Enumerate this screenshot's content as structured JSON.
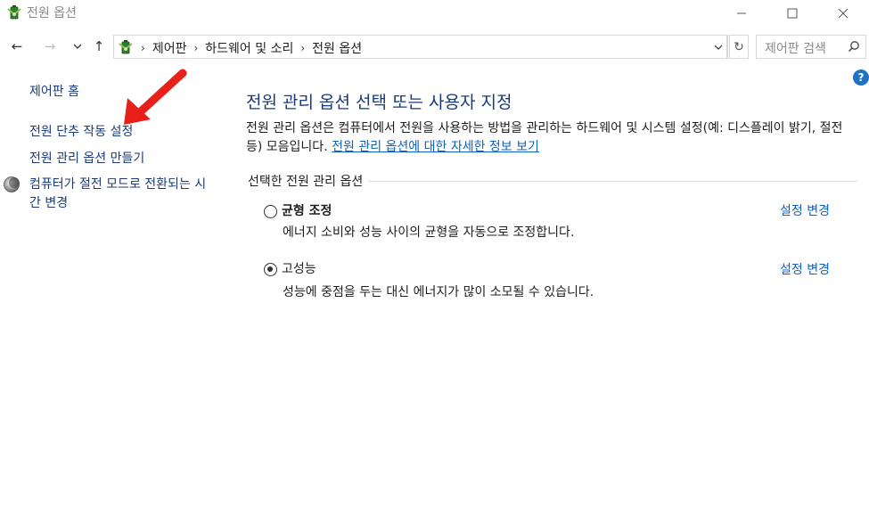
{
  "window": {
    "title": "전원 옵션",
    "minimize_glyph": "—",
    "maximize_glyph": "☐",
    "close_glyph": "✕"
  },
  "nav": {
    "back_glyph": "←",
    "forward_glyph": "→",
    "recent_glyph": "⌄",
    "up_glyph": "↑",
    "breadcrumbs": [
      "제어판",
      "하드웨어 및 소리",
      "전원 옵션"
    ],
    "separator": "›",
    "refresh_glyph": "↻",
    "dropdown_glyph": "⌄",
    "search_placeholder": "제어판 검색"
  },
  "help": {
    "label": "?"
  },
  "sidebar": {
    "home": "제어판 홈",
    "power_buttons": "전원 단추 작동 설정",
    "create_plan": "전원 관리 옵션 만들기",
    "sleep_time": "컴퓨터가 절전 모드로 전환되는 시간 변경"
  },
  "main": {
    "title": "전원 관리 옵션 선택 또는 사용자 지정",
    "description": "전원 관리 옵션은 컴퓨터에서 전원을 사용하는 방법을 관리하는 하드웨어 및 시스템 설정(예: 디스플레이 밝기, 절전 등) 모음입니다.",
    "more_info_link": "전원 관리 옵션에 대한 자세한 정보 보기",
    "group_label": "선택한 전원 관리 옵션",
    "plans": [
      {
        "name": "균형 조정",
        "description": "에너지 소비와 성능 사이의 균형을 자동으로 조정합니다.",
        "link": "설정 변경",
        "selected": false
      },
      {
        "name": "고성능",
        "description": "성능에 중점을 두는 대신 에너지가 많이 소모될 수 있습니다.",
        "link": "설정 변경",
        "selected": true
      }
    ]
  },
  "colors": {
    "link_blue": "#0b62c4",
    "nav_link": "#1a3a78",
    "annotation_arrow": "#e8201a",
    "help_blue": "#1f73c6"
  },
  "icons": {
    "app": "power-options-battery-icon",
    "search": "magnifier-icon",
    "sleep": "sleep-moon-icon",
    "annotation": "red-arrow-icon"
  }
}
